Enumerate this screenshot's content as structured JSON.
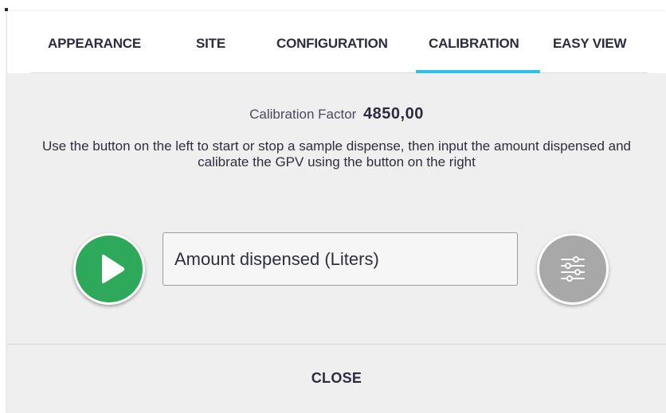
{
  "tabs": [
    {
      "label": "APPEARANCE"
    },
    {
      "label": "SITE"
    },
    {
      "label": "CONFIGURATION"
    },
    {
      "label": "CALIBRATION",
      "active": true
    },
    {
      "label": "EASY VIEW"
    }
  ],
  "calibration": {
    "factor_label": "Calibration Factor",
    "factor_value": "4850,00",
    "instructions": "Use the button on the left to start or stop a sample dispense, then input the amount dispensed and calibrate the GPV using the button on the right",
    "amount_placeholder": "Amount dispensed (Liters)",
    "amount_value": ""
  },
  "buttons": {
    "play_icon": "play-icon",
    "calibrate_icon": "sliders-icon",
    "close_label": "CLOSE"
  },
  "colors": {
    "accent": "#2fc0e8",
    "play_button": "#2ea85a",
    "calibrate_button": "#a8a8a8"
  }
}
